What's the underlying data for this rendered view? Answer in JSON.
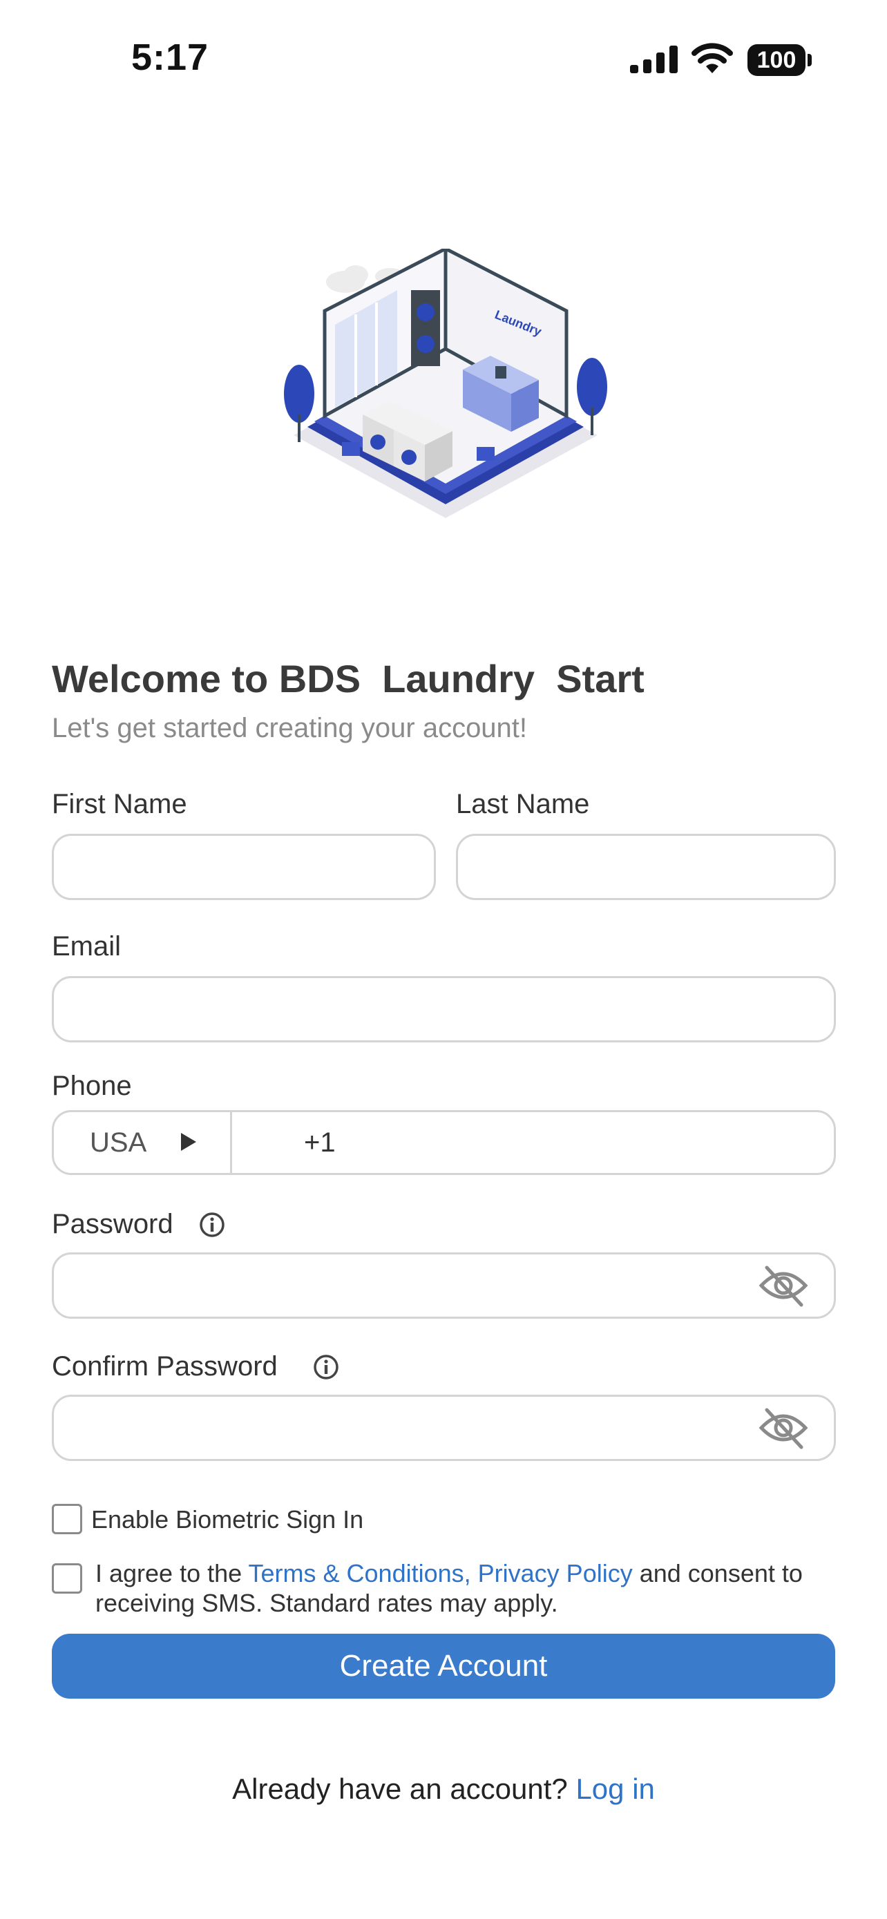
{
  "status_bar": {
    "time": "5:17",
    "battery": "100"
  },
  "header": {
    "title": "Welcome to BDS  Laundry  Start",
    "subtitle": "Let's get started creating your account!",
    "illustration_sign": "Laundry"
  },
  "form": {
    "first_name_label": "First Name",
    "last_name_label": "Last Name",
    "email_label": "Email",
    "phone_label": "Phone",
    "phone_country": "USA",
    "phone_code": "+1",
    "password_label": "Password",
    "confirm_password_label": "Confirm Password",
    "biometric_label": "Enable Biometric Sign In",
    "agree_prefix": "I agree to the ",
    "terms_link": "Terms & Conditions,",
    "privacy_link": "Privacy Policy",
    "agree_suffix": " and consent to receiving SMS. Standard rates may apply.",
    "create_button": "Create Account"
  },
  "footer": {
    "prompt": "Already have an account? ",
    "login_link": "Log in"
  },
  "colors": {
    "accent": "#3a7bcb",
    "link": "#2e73c8",
    "border": "#d4d4d4"
  }
}
